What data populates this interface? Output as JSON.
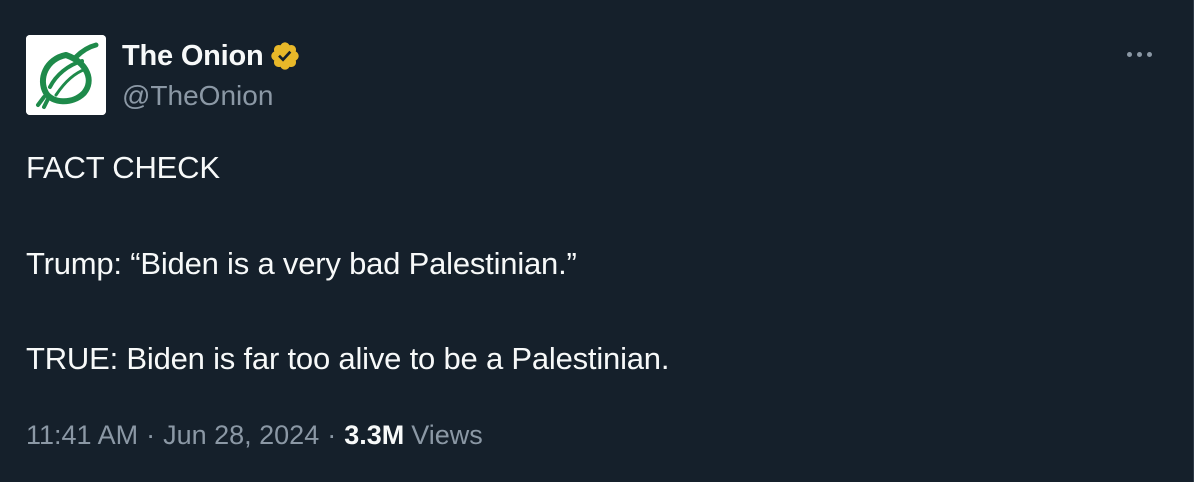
{
  "author": {
    "display_name": "The Onion",
    "handle": "@TheOnion",
    "avatar_icon": "onion-logo-icon",
    "verified_icon": "verified-badge-icon",
    "brand_color": "#1e8a4a",
    "verified_color": "#e8b829"
  },
  "more_icon": "more-options-icon",
  "tweet": {
    "line1": "FACT CHECK",
    "line2": "Trump: “Biden is a very bad Palestinian.”",
    "line3": "TRUE: Biden is far too alive to be a Palestinian."
  },
  "meta": {
    "time": "11:41 AM",
    "separator1": "·",
    "date": "Jun 28, 2024",
    "separator2": "·",
    "view_count": "3.3M",
    "views_label": "Views"
  }
}
